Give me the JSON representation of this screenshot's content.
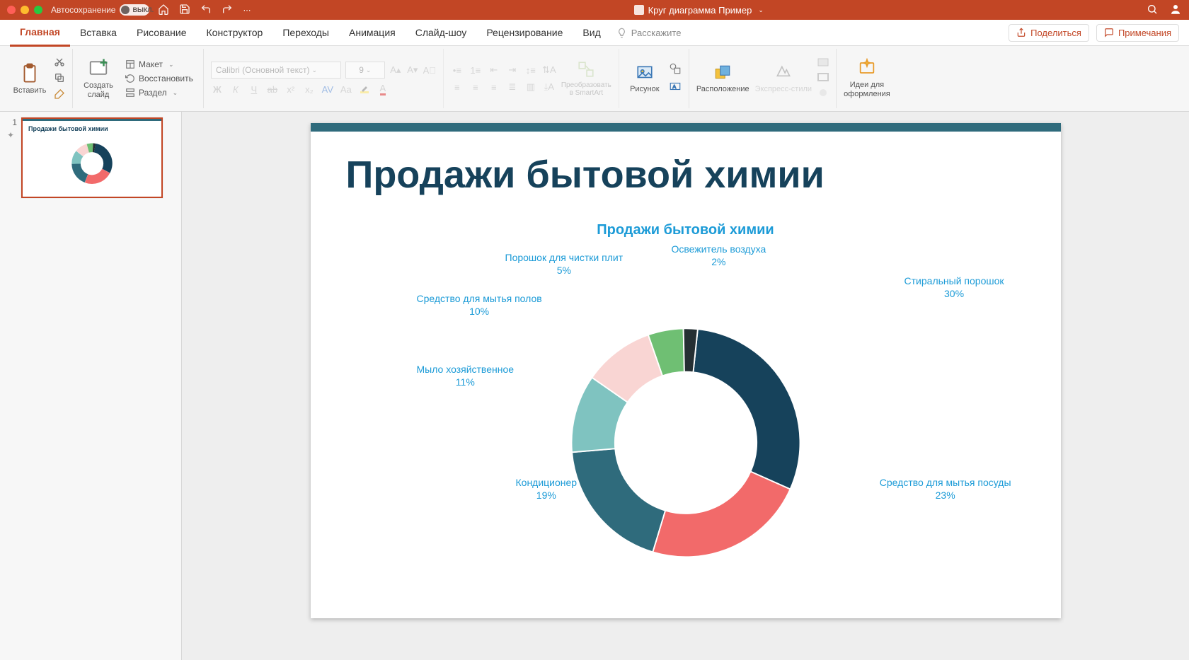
{
  "titlebar": {
    "autosave_label": "Автосохранение",
    "autosave_switch": "ВЫКЛ.",
    "document_title": "Круг диаграмма Пример"
  },
  "tabs": {
    "items": [
      "Главная",
      "Вставка",
      "Рисование",
      "Конструктор",
      "Переходы",
      "Анимация",
      "Слайд-шоу",
      "Рецензирование",
      "Вид"
    ],
    "active_index": 0,
    "tell_me": "Расскажите",
    "share": "Поделиться",
    "comments": "Примечания"
  },
  "ribbon": {
    "paste": "Вставить",
    "new_slide": "Создать\nслайд",
    "layout": "Макет",
    "reset": "Восстановить",
    "section": "Раздел",
    "font_name": "Calibri (Основной текст)",
    "font_size": "9",
    "convert_smartart": "Преобразовать\nв SmartArt",
    "picture": "Рисунок",
    "arrange": "Расположение",
    "quick_styles": "Экспресс-стили",
    "design_ideas": "Идеи для\nоформления"
  },
  "thumbnail": {
    "number": "1",
    "title": "Продажи бытовой химии"
  },
  "slide": {
    "title": "Продажи бытовой химии"
  },
  "chart_data": {
    "type": "pie",
    "title": "Продажи бытовой химии",
    "series": [
      {
        "name": "Стиральный порошок",
        "value": 30,
        "color": "#16425b",
        "label": "Стиральный порошок",
        "pct": "30%"
      },
      {
        "name": "Средство для мытья посуды",
        "value": 23,
        "color": "#f26a6a",
        "label": "Средство для мытья посуды",
        "pct": "23%"
      },
      {
        "name": "Кондиционер",
        "value": 19,
        "color": "#2f6b7c",
        "label": "Кондиционер",
        "pct": "19%"
      },
      {
        "name": "Мыло хозяйственное",
        "value": 11,
        "color": "#7fc3c0",
        "label": "Мыло хозяйственное",
        "pct": "11%"
      },
      {
        "name": "Средство для мытья полов",
        "value": 10,
        "color": "#f9d5d3",
        "label": "Средство для мытья полов",
        "pct": "10%"
      },
      {
        "name": "Порошок для чистки плит",
        "value": 5,
        "color": "#6fbf73",
        "label": "Порошок для чистки плит",
        "pct": "5%"
      },
      {
        "name": "Освежитель воздуха",
        "value": 2,
        "color": "#252f33",
        "label": "Освежитель воздуха",
        "pct": "2%"
      }
    ],
    "inner_radius_ratio": 0.62
  }
}
